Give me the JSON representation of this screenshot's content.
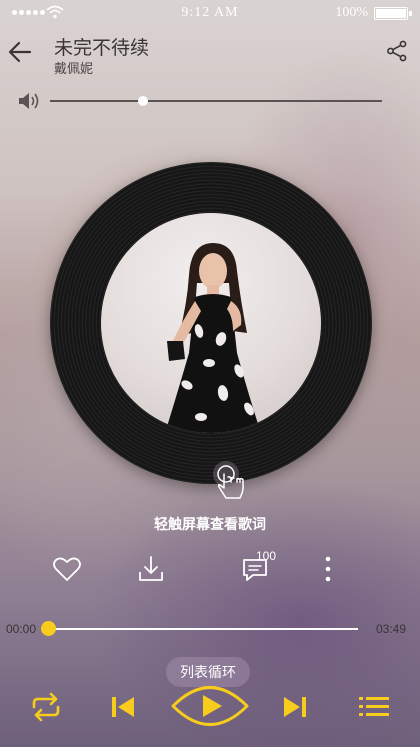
{
  "status_bar": {
    "time": "9:12 AM",
    "battery": "100%"
  },
  "header": {
    "title": "未完不待续",
    "artist": "戴佩妮"
  },
  "volume": {
    "level": 0.28
  },
  "disc": {
    "hint": "轻触屏幕查看歌词"
  },
  "actions": {
    "comment_count": "100"
  },
  "progress": {
    "current": "00:00",
    "total": "03:49",
    "fraction": 0.0
  },
  "playback": {
    "mode_label": "列表循环"
  },
  "colors": {
    "accent": "#f7cc1c",
    "text_dark": "#3a3434",
    "disc": "#161616"
  },
  "icons": [
    "back-arrow-icon",
    "share-icon",
    "volume-icon",
    "touch-hand-icon",
    "heart-icon",
    "download-icon",
    "comment-icon",
    "more-vertical-icon",
    "repeat-icon",
    "previous-icon",
    "play-icon",
    "next-icon",
    "playlist-icon"
  ]
}
